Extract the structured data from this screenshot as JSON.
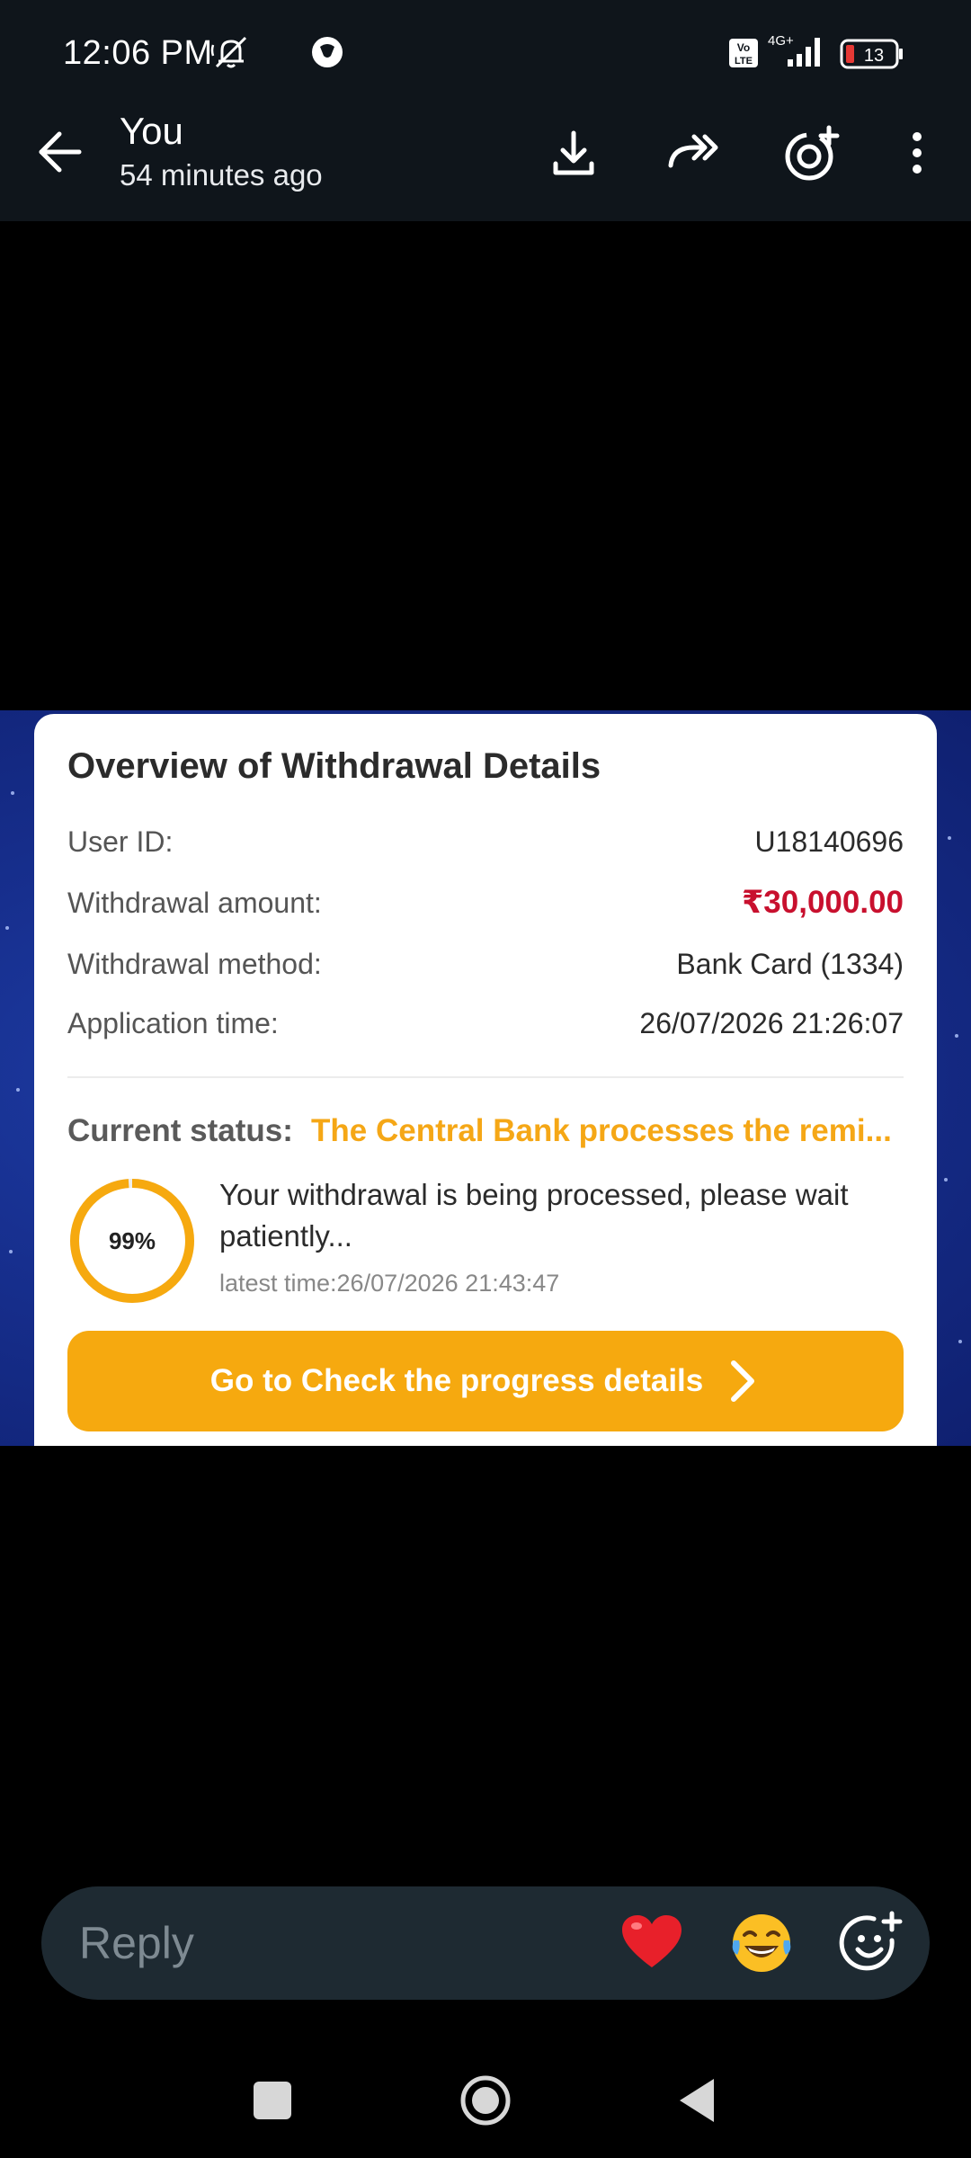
{
  "status_bar": {
    "time": "12:06 PM",
    "network": "4G+",
    "volte": "Vo LTE",
    "battery": "13"
  },
  "header": {
    "title": "You",
    "subtitle": "54 minutes ago"
  },
  "card": {
    "title": "Overview of Withdrawal Details",
    "rows": [
      {
        "label": "User ID:",
        "value": "U18140696"
      },
      {
        "label": "Withdrawal amount:",
        "value": "₹30,000.00"
      },
      {
        "label": "Withdrawal method:",
        "value": "Bank Card (1334)"
      },
      {
        "label": "Application time:",
        "value": "26/07/2026 21:26:07"
      }
    ],
    "status_label": "Current status:",
    "status_value": "The Central Bank processes the remi...",
    "progress_percent": 99,
    "progress_text": "99%",
    "message": "Your withdrawal is being processed, please wait patiently...",
    "latest_time": "latest time:26/07/2026 21:43:47",
    "cta_label": "Go to Check the progress details"
  },
  "reply": {
    "placeholder": "Reply"
  },
  "colors": {
    "accent": "#f6a90f",
    "amount_red": "#c8102e",
    "card_bg": "#ffffff",
    "story_blue": "#172f8e"
  }
}
